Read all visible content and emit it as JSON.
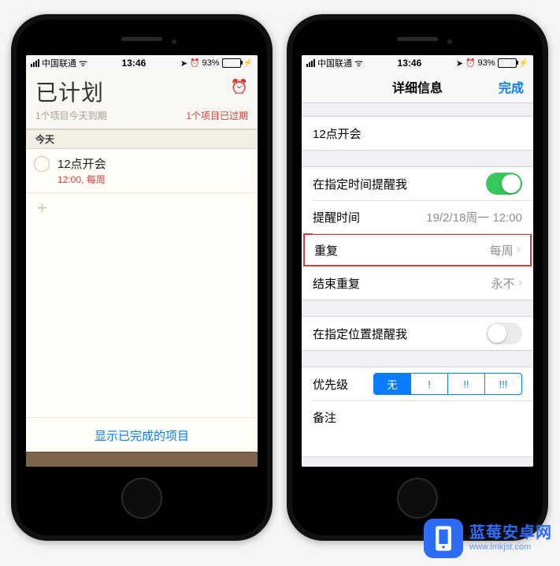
{
  "status": {
    "carrier": "中国联通",
    "time": "13:46",
    "battery_pct": "93%"
  },
  "left": {
    "title": "已计划",
    "subtitle_left": "1个项目今天到期",
    "subtitle_right": "1个项目已过期",
    "section_header": "今天",
    "todo": {
      "title": "12点开会",
      "detail": "12:00,  每周"
    },
    "add_symbol": "+",
    "show_completed": "显示已完成的项目"
  },
  "right": {
    "nav_title": "详细信息",
    "nav_done": "完成",
    "reminder_title": "12点开会",
    "remind_time_label": "在指定时间提醒我",
    "remind_time_on": true,
    "alarm_label": "提醒时间",
    "alarm_value": "19/2/18周一 12:00",
    "repeat_label": "重复",
    "repeat_value": "每周",
    "end_repeat_label": "结束重复",
    "end_repeat_value": "永不",
    "remind_loc_label": "在指定位置提醒我",
    "remind_loc_on": false,
    "priority_label": "优先级",
    "priority_options": [
      "无",
      "!",
      "!!",
      "!!!"
    ],
    "priority_selected_index": 0,
    "notes_label": "备注"
  },
  "watermark": {
    "name": "蓝莓安卓网",
    "url": "www.lmkjst.com"
  },
  "icons": {
    "alarm": "⏰",
    "wifi": "ᯤ",
    "loc": "➤",
    "alarm_small": "⏰",
    "chev": "›",
    "charge": "⚡"
  }
}
